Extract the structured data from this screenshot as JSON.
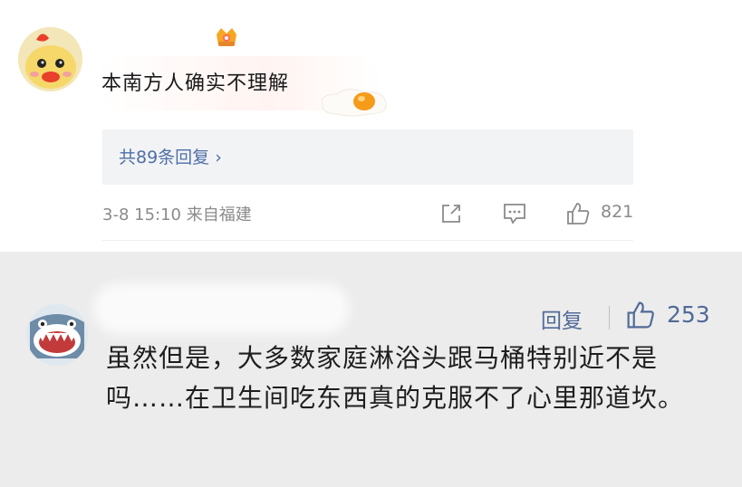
{
  "comment": {
    "text": "本南方人确实不理解",
    "reply_link": "共89条回复 ›",
    "timestamp": "3-8 15:10",
    "location": "来自福建",
    "like_count": "821",
    "icons": [
      "avatar-duck",
      "crown-badge-icon",
      "fried-egg-sticker",
      "share-icon",
      "comment-icon",
      "thumbs-up-icon"
    ]
  },
  "reply": {
    "reply_label": "回复",
    "like_count": "253",
    "text": "虽然但是，大多数家庭淋浴头跟马桶特别近不是吗……在卫生间吃东西真的克服不了心里那道坎。",
    "icons": [
      "avatar-shark",
      "thumbs-up-icon"
    ]
  },
  "colors": {
    "link": "#4f6fa7",
    "meta": "#8a8a8a",
    "reply_link": "#516a98",
    "bottom_bg": "#ececec"
  }
}
